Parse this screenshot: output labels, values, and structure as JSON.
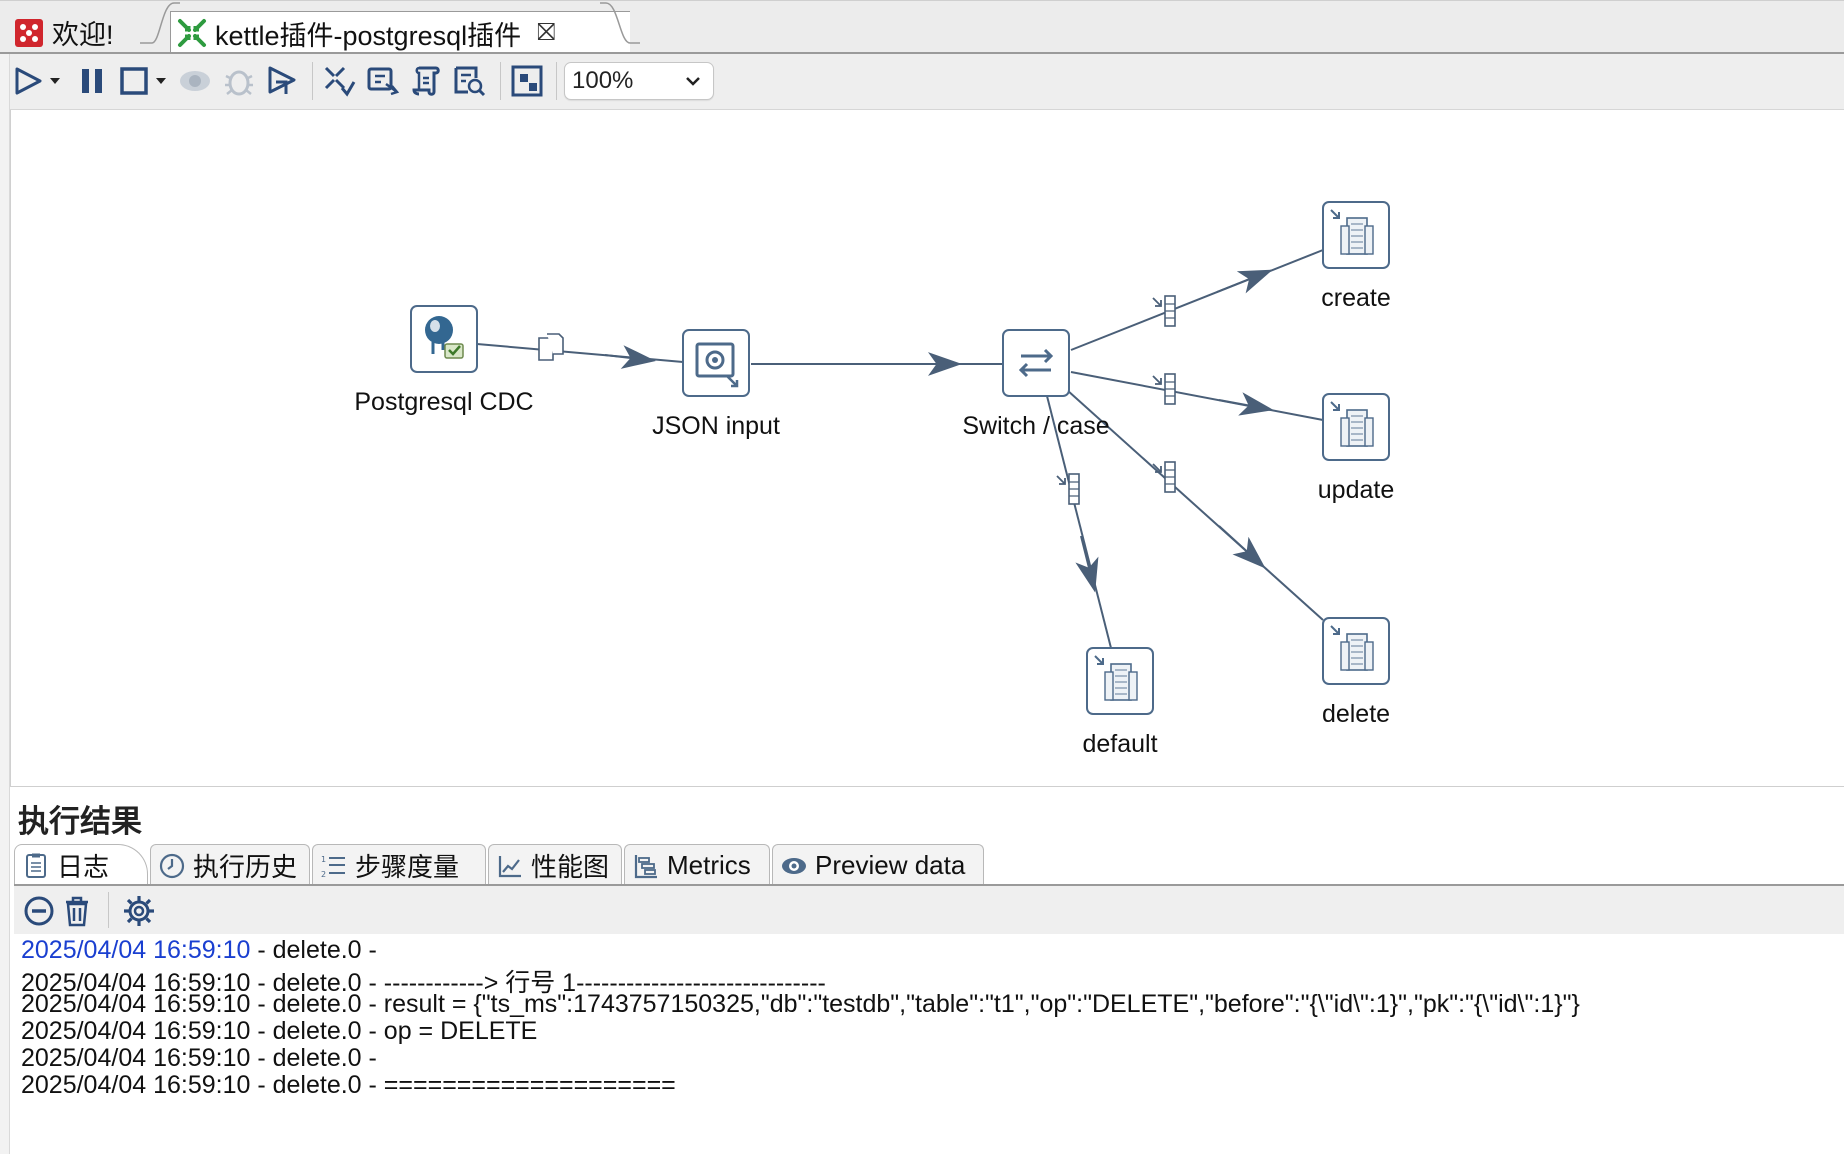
{
  "tabs": [
    {
      "label": "欢迎!",
      "icon": "welcome-icon"
    },
    {
      "label": "kettle插件-postgresql插件",
      "icon": "transformation-icon",
      "close": "⛝"
    }
  ],
  "toolbar": {
    "zoom": "100%",
    "icons": [
      "run-icon",
      "run-dropdown-icon",
      "pause-icon",
      "stop-icon",
      "stop-dropdown-icon",
      "preview-icon",
      "debug-icon",
      "replay-icon",
      "verify-icon",
      "impact-icon",
      "sql-icon",
      "explore-db-icon",
      "show-results-icon"
    ]
  },
  "canvas": {
    "steps": [
      {
        "name": "Postgresql CDC",
        "icon": "postgresql-cdc-icon"
      },
      {
        "name": "JSON input",
        "icon": "json-input-icon"
      },
      {
        "name": "Switch / case",
        "icon": "switch-case-icon"
      },
      {
        "name": "create",
        "icon": "dummy-step-icon"
      },
      {
        "name": "update",
        "icon": "dummy-step-icon"
      },
      {
        "name": "delete",
        "icon": "dummy-step-icon"
      },
      {
        "name": "default",
        "icon": "dummy-step-icon"
      }
    ],
    "hops": [
      {
        "from": "Postgresql CDC",
        "to": "JSON input",
        "icon": "copy-rows-icon"
      },
      {
        "from": "JSON input",
        "to": "Switch / case"
      },
      {
        "from": "Switch / case",
        "to": "create",
        "icon": "target-hop-icon"
      },
      {
        "from": "Switch / case",
        "to": "update",
        "icon": "target-hop-icon"
      },
      {
        "from": "Switch / case",
        "to": "delete",
        "icon": "target-hop-icon"
      },
      {
        "from": "Switch / case",
        "to": "default",
        "icon": "target-hop-icon"
      }
    ]
  },
  "results": {
    "title": "执行结果",
    "tabs": [
      {
        "label": "日志",
        "icon": "log-icon",
        "active": true
      },
      {
        "label": "执行历史",
        "icon": "history-icon"
      },
      {
        "label": "步骤度量",
        "icon": "step-metrics-icon"
      },
      {
        "label": "性能图",
        "icon": "performance-icon"
      },
      {
        "label": "Metrics",
        "icon": "metrics-icon"
      },
      {
        "label": "Preview data",
        "icon": "preview-data-icon"
      }
    ],
    "log_toolbar_icons": [
      "clear-log-icon",
      "delete-log-icon",
      "log-settings-icon"
    ],
    "log_lines": [
      {
        "timestamp": "2025/04/04 16:59:10",
        "text": " - delete.0 - ",
        "highlight": true
      },
      {
        "timestamp": "2025/04/04 16:59:10",
        "text": " - delete.0 - ------------> 行号 1------------------------------"
      },
      {
        "timestamp": "2025/04/04 16:59:10",
        "text": " - delete.0 - result = {\"ts_ms\":1743757150325,\"db\":\"testdb\",\"table\":\"t1\",\"op\":\"DELETE\",\"before\":\"{\\\"id\\\":1}\",\"pk\":\"{\\\"id\\\":1}\"}"
      },
      {
        "timestamp": "2025/04/04 16:59:10",
        "text": " - delete.0 - op = DELETE"
      },
      {
        "timestamp": "2025/04/04 16:59:10",
        "text": " - delete.0 - "
      },
      {
        "timestamp": "2025/04/04 16:59:10",
        "text": " - delete.0 - ===================="
      }
    ]
  },
  "colors": {
    "hop": "#4a5f78",
    "timestamp_highlight": "#1a3fd0",
    "step_border": "#4d6a8a"
  }
}
